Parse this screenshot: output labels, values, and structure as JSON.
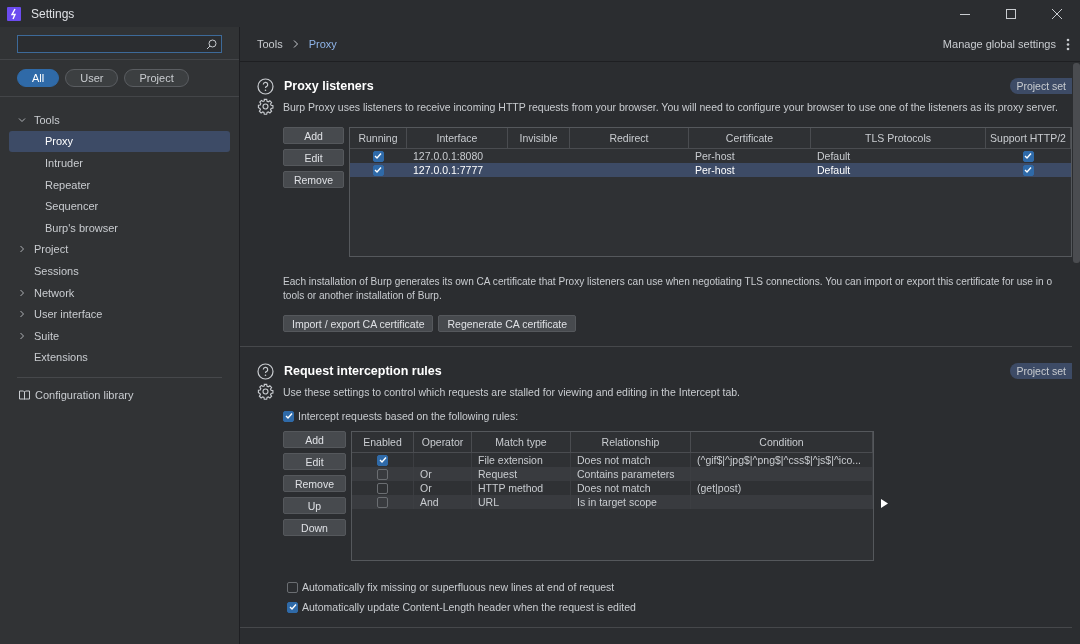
{
  "window": {
    "title": "Settings"
  },
  "sidebar": {
    "filters": [
      {
        "label": "All",
        "selected": true
      },
      {
        "label": "User",
        "selected": false
      },
      {
        "label": "Project",
        "selected": false
      }
    ],
    "tree": [
      {
        "label": "Tools",
        "expanded": true,
        "selected": false,
        "children": [
          {
            "label": "Proxy",
            "selected": true
          },
          {
            "label": "Intruder",
            "selected": false
          },
          {
            "label": "Repeater",
            "selected": false
          },
          {
            "label": "Sequencer",
            "selected": false
          },
          {
            "label": "Burp's browser",
            "selected": false
          }
        ]
      },
      {
        "label": "Project",
        "expanded": false,
        "selected": false
      },
      {
        "label": "Sessions",
        "selected": false
      },
      {
        "label": "Network",
        "expanded": false,
        "selected": false
      },
      {
        "label": "User interface",
        "expanded": false,
        "selected": false
      },
      {
        "label": "Suite",
        "expanded": false,
        "selected": false
      },
      {
        "label": "Extensions",
        "selected": false
      }
    ],
    "footer": "Configuration library"
  },
  "breadcrumb": [
    "Tools",
    "Proxy"
  ],
  "manage": "Manage global settings",
  "sections": [
    {
      "title": "Proxy listeners",
      "badge": "Project set",
      "description": "Burp Proxy uses listeners to receive incoming HTTP requests from your browser. You will need to configure your browser to use one of the listeners as its proxy server.",
      "buttons": [
        "Add",
        "Edit",
        "Remove"
      ],
      "table": {
        "columns": [
          "Running",
          "Interface",
          "Invisible",
          "Redirect",
          "Certificate",
          "TLS Protocols",
          "Support HTTP/2"
        ],
        "rows": [
          {
            "selected": false,
            "cells": [
              {
                "kind": "check",
                "checked": true
              },
              {
                "kind": "text",
                "text": "127.0.0.1:8080"
              },
              {
                "kind": "text",
                "text": ""
              },
              {
                "kind": "text",
                "text": ""
              },
              {
                "kind": "text",
                "text": "Per-host"
              },
              {
                "kind": "text",
                "text": "Default"
              },
              {
                "kind": "check",
                "checked": true
              }
            ]
          },
          {
            "selected": true,
            "cells": [
              {
                "kind": "check",
                "checked": true
              },
              {
                "kind": "text",
                "text": "127.0.0.1:7777"
              },
              {
                "kind": "text",
                "text": ""
              },
              {
                "kind": "text",
                "text": ""
              },
              {
                "kind": "text",
                "text": "Per-host"
              },
              {
                "kind": "text",
                "text": "Default"
              },
              {
                "kind": "check",
                "checked": true
              }
            ]
          }
        ]
      },
      "note": [
        "Each installation of Burp generates its own CA certificate that Proxy listeners can use when negotiating TLS connections. You can import or export this certificate for use in o",
        "tools or another installation of Burp."
      ],
      "actions": [
        "Import / export CA certificate",
        "Regenerate CA certificate"
      ]
    },
    {
      "title": "Request interception rules",
      "badge": "Project set",
      "description": "Use these settings to control which requests are stalled for viewing and editing in the Intercept tab.",
      "toggle": {
        "label": "Intercept requests based on the following rules:",
        "checked": true
      },
      "buttons": [
        "Add",
        "Edit",
        "Remove",
        "Up",
        "Down"
      ],
      "table": {
        "columns": [
          "Enabled",
          "Operator",
          "Match type",
          "Relationship",
          "Condition"
        ],
        "rows": [
          {
            "selected": false,
            "cells": [
              {
                "kind": "check",
                "checked": true
              },
              {
                "kind": "text",
                "text": ""
              },
              {
                "kind": "text",
                "text": "File extension"
              },
              {
                "kind": "text",
                "text": "Does not match"
              },
              {
                "kind": "text",
                "text": "(^gif$|^jpg$|^png$|^css$|^js$|^ico..."
              }
            ]
          },
          {
            "selected": false,
            "cells": [
              {
                "kind": "check",
                "checked": false
              },
              {
                "kind": "text",
                "text": "Or"
              },
              {
                "kind": "text",
                "text": "Request"
              },
              {
                "kind": "text",
                "text": "Contains parameters"
              },
              {
                "kind": "text",
                "text": ""
              }
            ]
          },
          {
            "selected": false,
            "cells": [
              {
                "kind": "check",
                "checked": false
              },
              {
                "kind": "text",
                "text": "Or"
              },
              {
                "kind": "text",
                "text": "HTTP method"
              },
              {
                "kind": "text",
                "text": "Does not match"
              },
              {
                "kind": "text",
                "text": "(get|post)"
              }
            ]
          },
          {
            "selected": false,
            "cells": [
              {
                "kind": "check",
                "checked": false
              },
              {
                "kind": "text",
                "text": "And"
              },
              {
                "kind": "text",
                "text": "URL"
              },
              {
                "kind": "text",
                "text": "Is in target scope"
              },
              {
                "kind": "text",
                "text": ""
              }
            ]
          }
        ]
      },
      "options": [
        {
          "label": "Automatically fix missing or superfluous new lines at end of request",
          "checked": false
        },
        {
          "label": "Automatically update Content-Length header when the request is edited",
          "checked": true
        }
      ]
    }
  ]
}
